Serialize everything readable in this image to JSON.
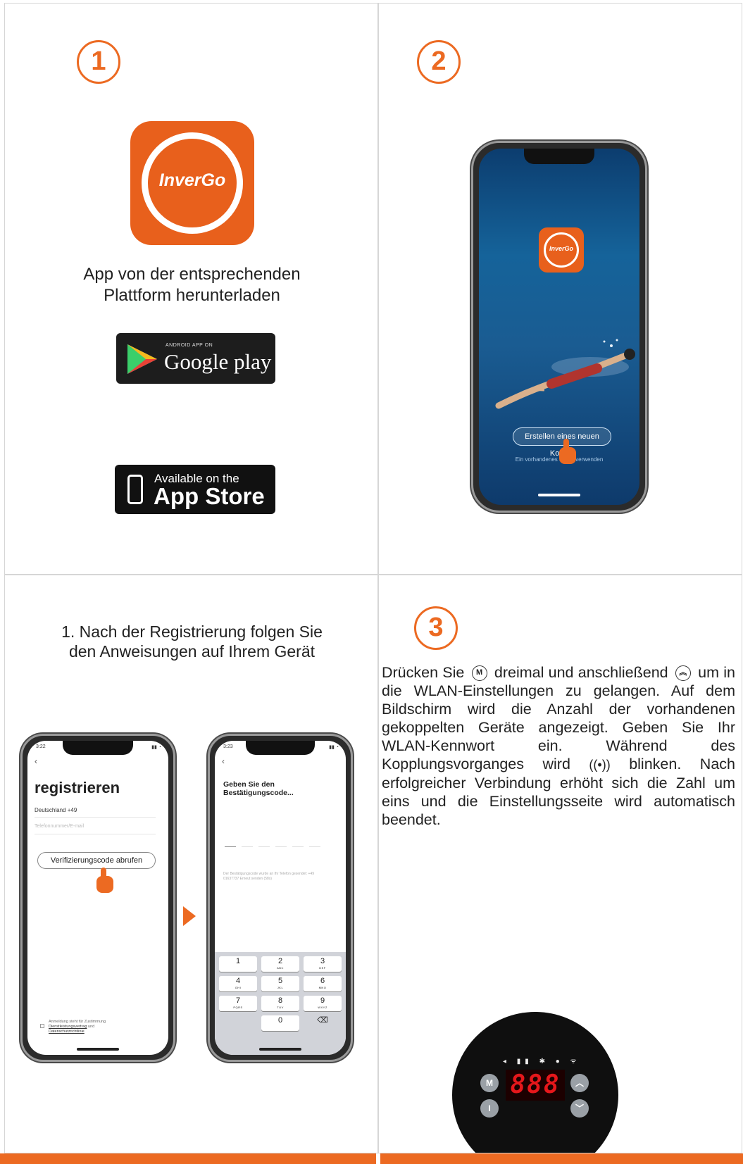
{
  "colors": {
    "accent": "#ec6a22",
    "app_icon": "#e8601c",
    "led": "#e6171b"
  },
  "step1": {
    "number": "1",
    "app_icon_name": "InverGo",
    "download_text_line1": "App von der entsprechenden",
    "download_text_line2": "Plattform herunterladen",
    "google_play_small": "ANDROID APP ON",
    "google_play_big": "Google play",
    "app_store_small": "Available on the",
    "app_store_big": "App Store"
  },
  "step2": {
    "number": "2",
    "app_icon_name": "InverGo",
    "create_account_button": "Erstellen eines neuen Kontos",
    "use_existing_link": "Ein vorhandenes Konto verwenden"
  },
  "step_register": {
    "instruction_line1": "1. Nach der Registrierung folgen Sie",
    "instruction_line2": "den Anweisungen auf Ihrem Gerät",
    "phone_a": {
      "time": "3:22",
      "title": "registrieren",
      "country": "Deutschland +49",
      "phone_placeholder": "Telefonnummer/E-mail",
      "verify_button": "Verifizierungscode abrufen",
      "consent_line1": "Anmeldung steht für Zustimmung",
      "consent_link1": "Dienstleistungsvertrag",
      "consent_and": "und",
      "consent_link2": "Datenschutzrichtlinie"
    },
    "phone_b": {
      "time": "3:23",
      "title": "Geben Sie den Bestätigungscode...",
      "note": "Der Bestätigungscode wurde an Ihr Telefon gesendet: +49 01637737 Erneut senden (58s)",
      "keys": [
        {
          "n": "1",
          "s": ""
        },
        {
          "n": "2",
          "s": "ABC"
        },
        {
          "n": "3",
          "s": "DEF"
        },
        {
          "n": "4",
          "s": "GHI"
        },
        {
          "n": "5",
          "s": "JKL"
        },
        {
          "n": "6",
          "s": "MNO"
        },
        {
          "n": "7",
          "s": "PQRS"
        },
        {
          "n": "8",
          "s": "TUV"
        },
        {
          "n": "9",
          "s": "WXYZ"
        },
        {
          "n": "",
          "s": ""
        },
        {
          "n": "0",
          "s": ""
        },
        {
          "n": "⌫",
          "s": ""
        }
      ]
    }
  },
  "step3": {
    "number": "3",
    "text_part1": "Drücken Sie",
    "icon_m": "M",
    "text_part2": "dreimal und anschließend",
    "text_part3": "um in die WLAN-Einstellungen zu gelangen. Auf dem Bildschirm wird die Anzahl der vorhandenen gekoppelten Geräte angezeigt. Geben Sie Ihr WLAN-Kennwort ein. Während des Kopplungsvorganges wird",
    "text_part4": "blinken. Nach erfolgreicher Verbindung erhöht sich die Zahl um eins und die Einstellungsseite wird automatisch beendet.",
    "led_value": "888",
    "panel_btn_m": "M",
    "panel_btn_power": "I"
  }
}
